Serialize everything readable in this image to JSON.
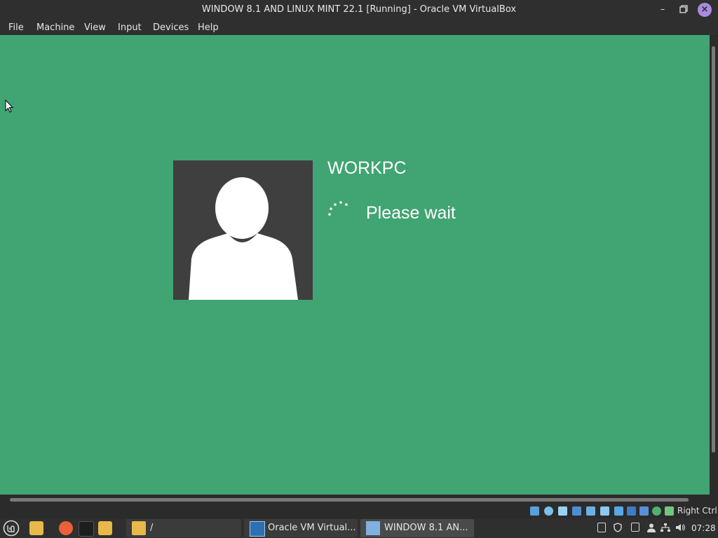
{
  "window": {
    "title": "WINDOW 8.1 AND LINUX MINT 22.1 [Running] - Oracle VM VirtualBox",
    "minimize_icon": "minimize-icon",
    "maximize_icon": "restore-icon",
    "close_icon": "close-icon"
  },
  "menu": {
    "items": [
      "File",
      "Machine",
      "View",
      "Input",
      "Devices",
      "Help"
    ]
  },
  "guest": {
    "background_color": "#41a473",
    "username": "WORKPC",
    "status_text": "Please wait",
    "avatar_icon": "user-avatar-icon",
    "spinner_icon": "loading-spinner-icon"
  },
  "vbox_status": {
    "host_key": "Right Ctrl",
    "icons": [
      "hard-disk-icon",
      "optical-drive-icon",
      "audio-icon",
      "network-icon",
      "usb-icon",
      "shared-folders-icon",
      "display-icon",
      "recording-icon",
      "cpu-icon",
      "mouse-integration-icon",
      "keyboard-icon"
    ]
  },
  "taskbar": {
    "menu_icon": "linux-mint-menu-icon",
    "launchers": [
      "files-launcher-icon",
      "firefox-launcher-icon",
      "terminal-launcher-icon",
      "folder-launcher-icon"
    ],
    "tasks": [
      {
        "label": "/",
        "icon": "folder-icon"
      },
      {
        "label": "Oracle VM Virtual...",
        "icon": "virtualbox-icon"
      },
      {
        "label": "WINDOW 8.1 AN...",
        "icon": "vm-window-icon"
      }
    ],
    "tray_icons": [
      "clipboard-icon",
      "shield-icon",
      "notes-icon",
      "user-icon",
      "network-tray-icon",
      "volume-icon"
    ],
    "clock": "07:28"
  }
}
